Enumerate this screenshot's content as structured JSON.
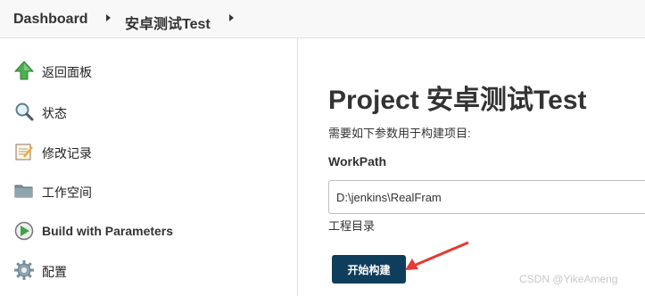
{
  "breadcrumb": {
    "items": [
      "Dashboard",
      "安卓测试Test"
    ]
  },
  "sidebar": {
    "items": [
      {
        "label": "返回面板",
        "icon": "up-arrow-icon"
      },
      {
        "label": "状态",
        "icon": "magnifier-icon"
      },
      {
        "label": "修改记录",
        "icon": "notepad-icon"
      },
      {
        "label": "工作空间",
        "icon": "folder-icon"
      },
      {
        "label": "Build with Parameters",
        "icon": "build-clock-icon"
      },
      {
        "label": "配置",
        "icon": "gear-icon"
      }
    ]
  },
  "main": {
    "title": "Project 安卓测试Test",
    "description": "需要如下参数用于构建项目:",
    "parameter": {
      "name": "WorkPath",
      "value": "D:\\jenkins\\RealFram",
      "description": "工程目录"
    },
    "build_button": "开始构建"
  },
  "watermark": "CSDN @YikeAmeng",
  "colors": {
    "build_button": "#0f3d5c",
    "annotation_arrow": "#e53935",
    "breadcrumb_bg": "#f8f8f8"
  }
}
